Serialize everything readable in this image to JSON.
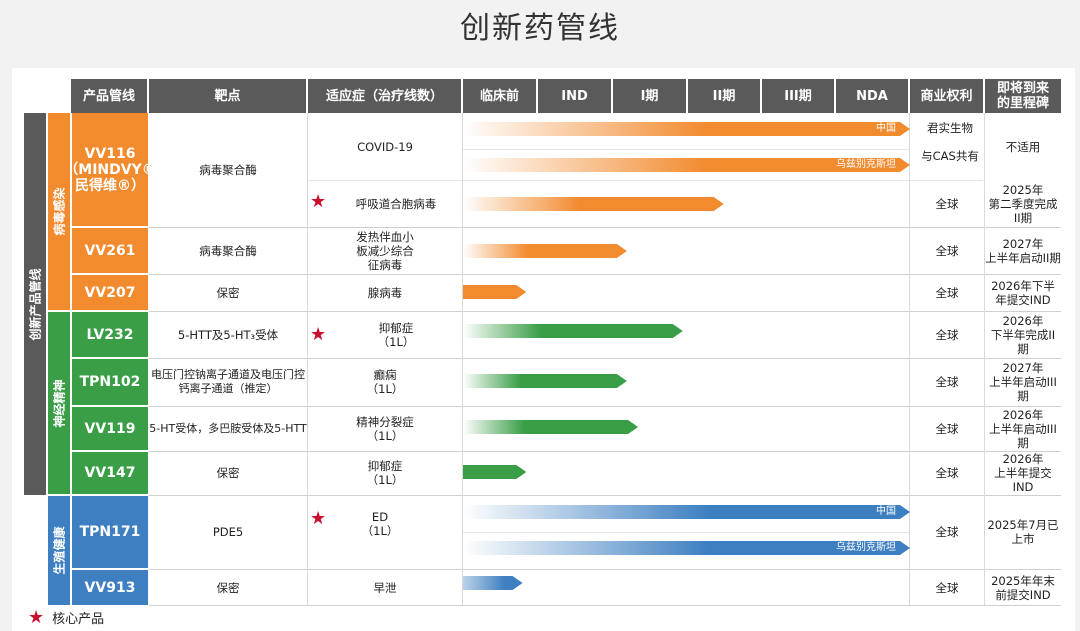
{
  "title": "创新药管线",
  "headers": {
    "product": "产品管线",
    "target": "靶点",
    "indication": "适应症（治疗线数）",
    "phases": [
      "临床前",
      "IND",
      "I期",
      "II期",
      "III期",
      "NDA"
    ],
    "rights": "商业权利",
    "milestone": "即将到来\n的里程碑"
  },
  "outer_category": "创新产品管线",
  "areas": [
    {
      "name": "病毒感染",
      "color": "#f28a2e"
    },
    {
      "name": "神经精神",
      "color": "#3a9e47"
    },
    {
      "name": "生殖健康",
      "color": "#3d7fc1"
    }
  ],
  "colors": {
    "orange": "#f28a2e",
    "green": "#3a9e47",
    "blue": "#3d7fc1",
    "header": "#5a5a5a",
    "sidebar": "#5a5a5a",
    "star": "#c8102e"
  },
  "rows": {
    "vv116": {
      "product": "VV116\n（MINDVY®\n民得维®）",
      "target": "病毒聚合酶",
      "covid": "COVID-19",
      "rsv": "呼吸道合胞病毒",
      "covid_rights_1": "君实生物",
      "covid_rights_2": "与CAS共有",
      "covid_milestone": "不适用",
      "rsv_rights": "全球",
      "rsv_milestone": "2025年\n第二季度完成\nII期",
      "bar1_label": "中国",
      "bar2_label": "乌兹别克斯坦"
    },
    "vv261": {
      "product": "VV261",
      "target": "病毒聚合酶",
      "indication": "发热伴血小\n板减少综合\n征病毒",
      "rights": "全球",
      "milestone": "2027年\n上半年启动II期"
    },
    "vv207": {
      "product": "VV207",
      "target": "保密",
      "indication": "腺病毒",
      "rights": "全球",
      "milestone": "2026年下半\n年提交IND"
    },
    "lv232": {
      "product": "LV232",
      "target": "5-HTT及5-HT₃受体",
      "indication": "抑郁症\n（1L）",
      "rights": "全球",
      "milestone": "2026年\n下半年完成II\n期"
    },
    "tpn102": {
      "product": "TPN102",
      "target": "电压门控钠离子通道及电压门控\n钙离子通道（推定）",
      "indication": "癫痫\n（1L）",
      "rights": "全球",
      "milestone": "2027年\n上半年启动III期"
    },
    "vv119": {
      "product": "VV119",
      "target": "5-HT受体，多巴胺受体及5-HTT",
      "indication": "精神分裂症\n（1L）",
      "rights": "全球",
      "milestone": "2026年\n上半年启动III期"
    },
    "vv147": {
      "product": "VV147",
      "target": "保密",
      "indication": "抑郁症\n（1L）",
      "rights": "全球",
      "milestone": "2026年\n上半年提交\nIND"
    },
    "tpn171": {
      "product": "TPN171",
      "target": "PDE5",
      "indication": "ED\n（1L）",
      "rights": "全球",
      "milestone": "2025年7月已\n上市",
      "bar1_label": "中国",
      "bar2_label": "乌兹别克斯坦"
    },
    "vv913": {
      "product": "VV913",
      "target": "保密",
      "indication": "早泄",
      "rights": "全球",
      "milestone": "2025年年末\n前提交IND"
    }
  },
  "progress_phase_fraction": {
    "vv116_covid_china": 6.0,
    "vv116_covid_uzbekistan": 6.0,
    "vv116_rsv": 3.5,
    "vv261": 2.2,
    "vv207": 0.85,
    "lv232": 2.95,
    "tpn102": 2.2,
    "vv119": 2.35,
    "vv147": 0.85,
    "tpn171_china": 6.0,
    "tpn171_uzbekistan": 6.0,
    "vv913": 0.8
  },
  "legend": {
    "symbol": "★",
    "label": "核心产品"
  }
}
